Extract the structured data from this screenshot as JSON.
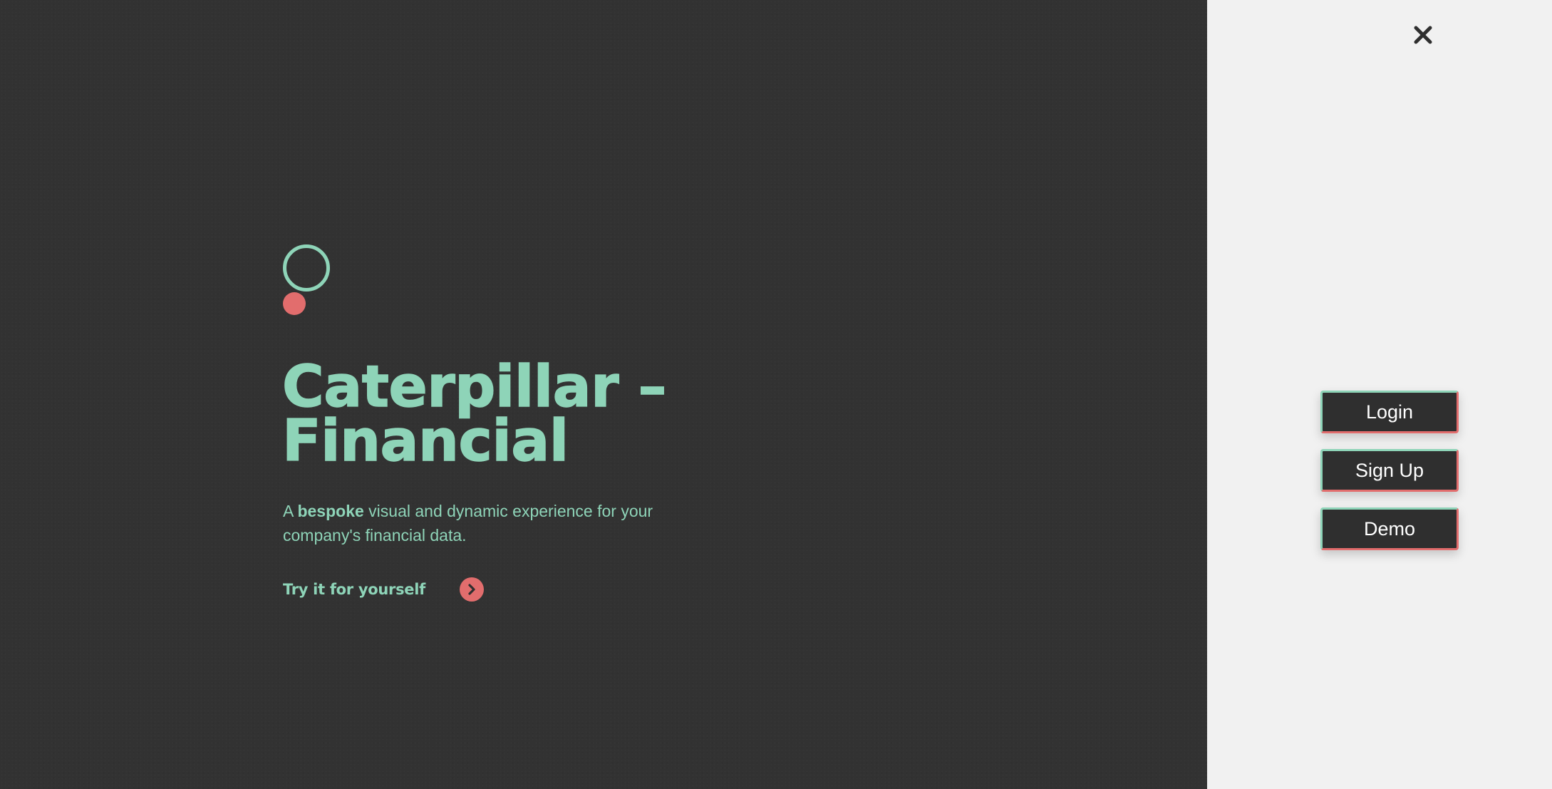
{
  "colors": {
    "background_dark": "#323232",
    "panel_light": "#f1f1f1",
    "accent_mint": "#8ed4b8",
    "accent_coral": "#e26d6d"
  },
  "hero": {
    "logo": {
      "icon": "circle-logo-icon"
    },
    "title": "Caterpillar – Financial",
    "subtitle_prefix": "A ",
    "subtitle_bold": "bespoke",
    "subtitle_suffix": " visual and dynamic experience for your company's financial data.",
    "cta_label": "Try it for yourself",
    "cta_icon": "chevron-right-icon"
  },
  "panel": {
    "close_icon": "close-icon",
    "menu": [
      {
        "label": "Login"
      },
      {
        "label": "Sign Up"
      },
      {
        "label": "Demo"
      }
    ]
  }
}
